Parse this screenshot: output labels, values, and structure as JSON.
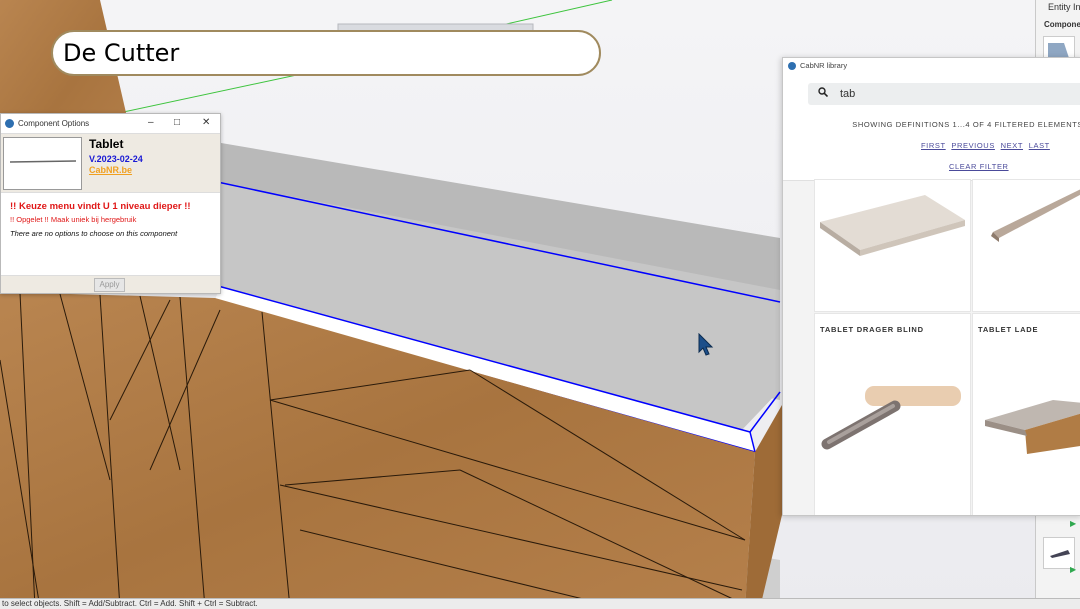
{
  "overlay_title": "De Cutter",
  "side_panel": {
    "header": "Entity In",
    "section": "Componen"
  },
  "status_bar": {
    "text": "to select objects. Shift = Add/Subtract. Ctrl = Add. Shift + Ctrl = Subtract."
  },
  "component_options": {
    "window_title": "Component Options",
    "name": "Tablet",
    "version": "V.2023-02-24",
    "link": "CabNR.be",
    "warning_main": "!! Keuze menu vindt U 1 niveau dieper !!",
    "warning_sub": "!! Opgelet !! Maak uniek bij hergebruik",
    "info": "There are no options to choose on this component",
    "apply_label": "Apply"
  },
  "library": {
    "window_title": "CabNR library",
    "search_value": "tab",
    "count_text": "SHOWING DEFINITIONS 1...4 OF 4 FILTERED ELEMENTS",
    "nav": [
      "FIRST",
      "PREVIOUS",
      "NEXT",
      "LAST"
    ],
    "clear_filter": "CLEAR FILTER",
    "cards": [
      {
        "label": ""
      },
      {
        "label": ""
      },
      {
        "label": "TABLET DRAGER BLIND"
      },
      {
        "label": "TABLET LADE"
      }
    ]
  },
  "colors": {
    "wood": "#b07c45",
    "countertop": "#c2c2c2",
    "selection": "#0000ff",
    "pill_border": "#a08a5e"
  }
}
